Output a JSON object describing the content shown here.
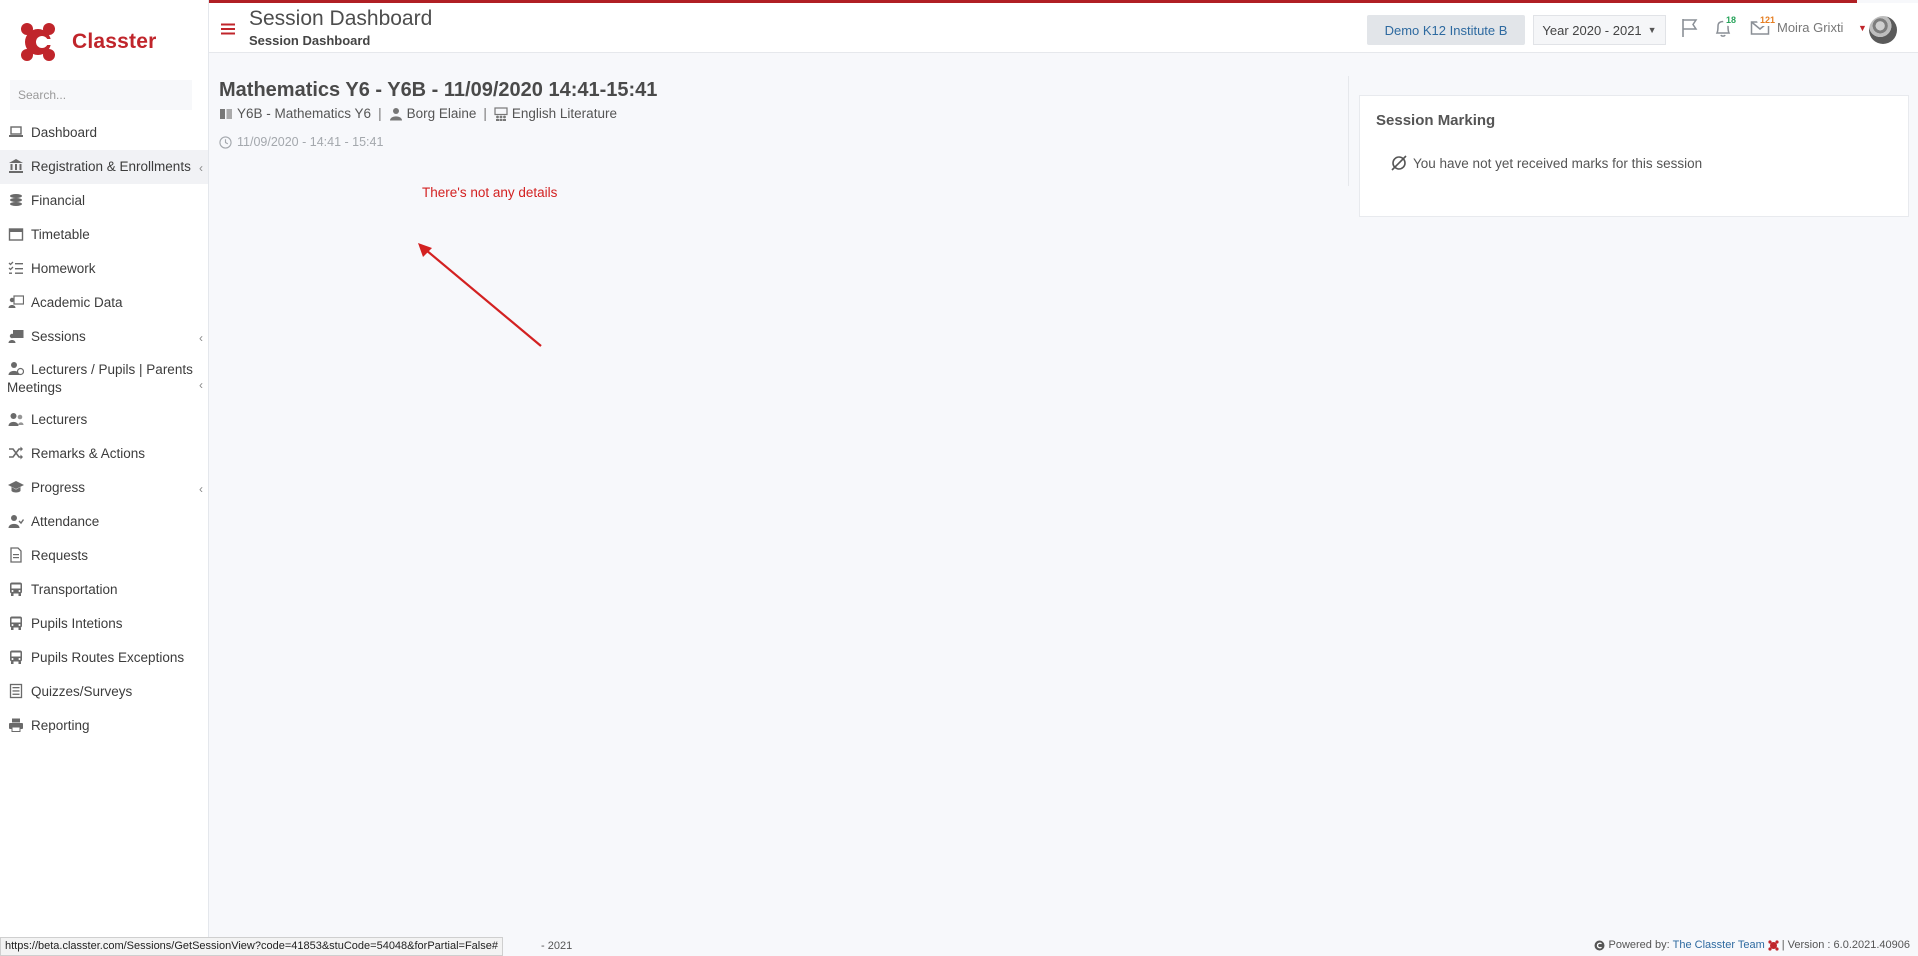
{
  "brand": {
    "name": "Classter"
  },
  "search": {
    "placeholder": "Search..."
  },
  "sidebar": {
    "items": [
      {
        "label": "Dashboard",
        "icon": "laptop-icon"
      },
      {
        "label": "Registration & Enrollments",
        "icon": "institution-icon"
      },
      {
        "label": "Financial",
        "icon": "coins-icon"
      },
      {
        "label": "Timetable",
        "icon": "calendar-icon"
      },
      {
        "label": "Homework",
        "icon": "checklist-icon"
      },
      {
        "label": "Academic Data",
        "icon": "teacher-board-icon"
      },
      {
        "label": "Sessions",
        "icon": "sessions-icon"
      },
      {
        "label": "Lecturers / Pupils | Parents Meetings",
        "icon": "user-clock-icon"
      },
      {
        "label": "Lecturers",
        "icon": "users-icon"
      },
      {
        "label": "Remarks & Actions",
        "icon": "shuffle-icon"
      },
      {
        "label": "Progress",
        "icon": "graduation-cap-icon"
      },
      {
        "label": "Attendance",
        "icon": "user-check-icon"
      },
      {
        "label": "Requests",
        "icon": "file-icon"
      },
      {
        "label": "Transportation",
        "icon": "bus-icon"
      },
      {
        "label": "Pupils Intetions",
        "icon": "bus-icon"
      },
      {
        "label": "Pupils Routes Exceptions",
        "icon": "bus-icon"
      },
      {
        "label": "Quizzes/Surveys",
        "icon": "list-icon"
      },
      {
        "label": "Reporting",
        "icon": "print-icon"
      }
    ]
  },
  "header": {
    "title": "Session Dashboard",
    "subtitle": "Session Dashboard",
    "institute": "Demo K12 Institute B",
    "year": "Year 2020 - 2021",
    "notifications_count": "18",
    "messages_count": "121",
    "user_name": "Moira Grixti"
  },
  "session": {
    "title": "Mathematics Y6 - Y6B - 11/09/2020 14:41-15:41",
    "course": "Y6B - Mathematics Y6",
    "lecturer": "Borg Elaine",
    "subject": "English Literature",
    "time": "11/09/2020 - 14:41 - 15:41",
    "no_details": "There's not any details"
  },
  "marking": {
    "title": "Session Marking",
    "message": "You have not yet received marks for this session"
  },
  "footer": {
    "status_url": "https://beta.classter.com/Sessions/GetSessionView?code=41853&stuCode=54048&forPartial=False#",
    "year_fragment": "- 2021",
    "powered_by": "Powered by:",
    "team": "The Classter Team",
    "version": "| Version : 6.0.2021.40906"
  },
  "colors": {
    "brand_red": "#c0252b",
    "link_blue": "#2e6aa0",
    "annotation_red": "#d32121"
  }
}
